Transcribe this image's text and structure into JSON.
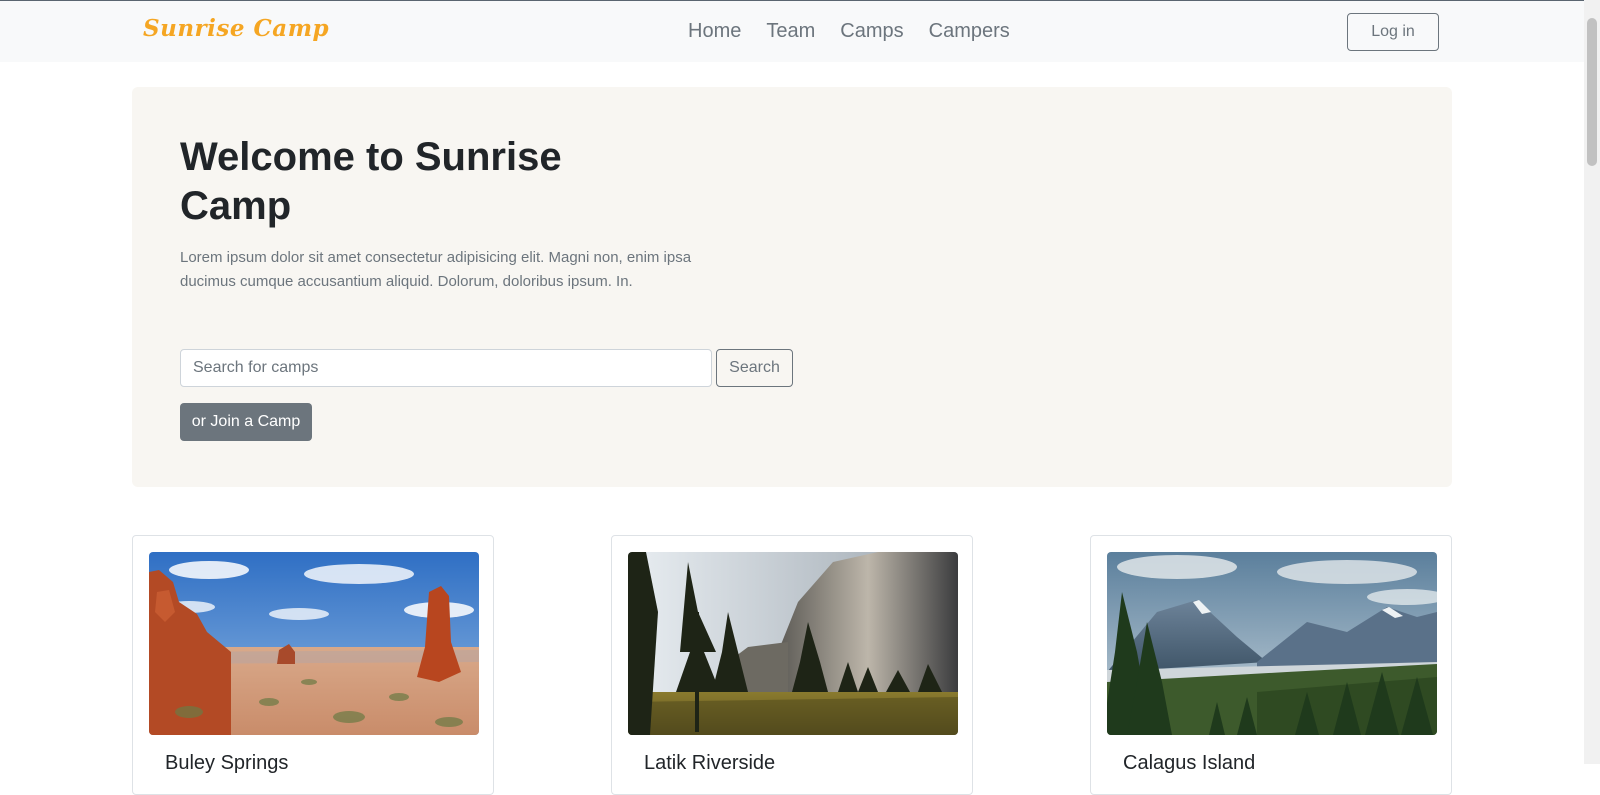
{
  "navbar": {
    "brand": "Sunrise Camp",
    "links": [
      "Home",
      "Team",
      "Camps",
      "Campers"
    ],
    "login_label": "Log in"
  },
  "hero": {
    "title": "Welcome to Sunrise Camp",
    "text": "Lorem ipsum dolor sit amet consectetur adipisicing elit. Magni non, enim ipsa ducimus cumque accusantium aliquid. Dolorum, doloribus ipsum. In.",
    "search_placeholder": "Search for camps",
    "search_value": "",
    "search_label": "Search",
    "join_label": "or Join a Camp"
  },
  "cards": [
    {
      "title": "Buley Springs",
      "image": "desert-arches-photo"
    },
    {
      "title": "Latik Riverside",
      "image": "granite-cliff-forest-photo"
    },
    {
      "title": "Calagus Island",
      "image": "mountain-valley-lake-photo"
    }
  ],
  "colors": {
    "brand": "#f5a623",
    "hero_bg": "#f8f6f2",
    "navbar_bg": "#f8f9fa",
    "secondary": "#6c757d"
  }
}
